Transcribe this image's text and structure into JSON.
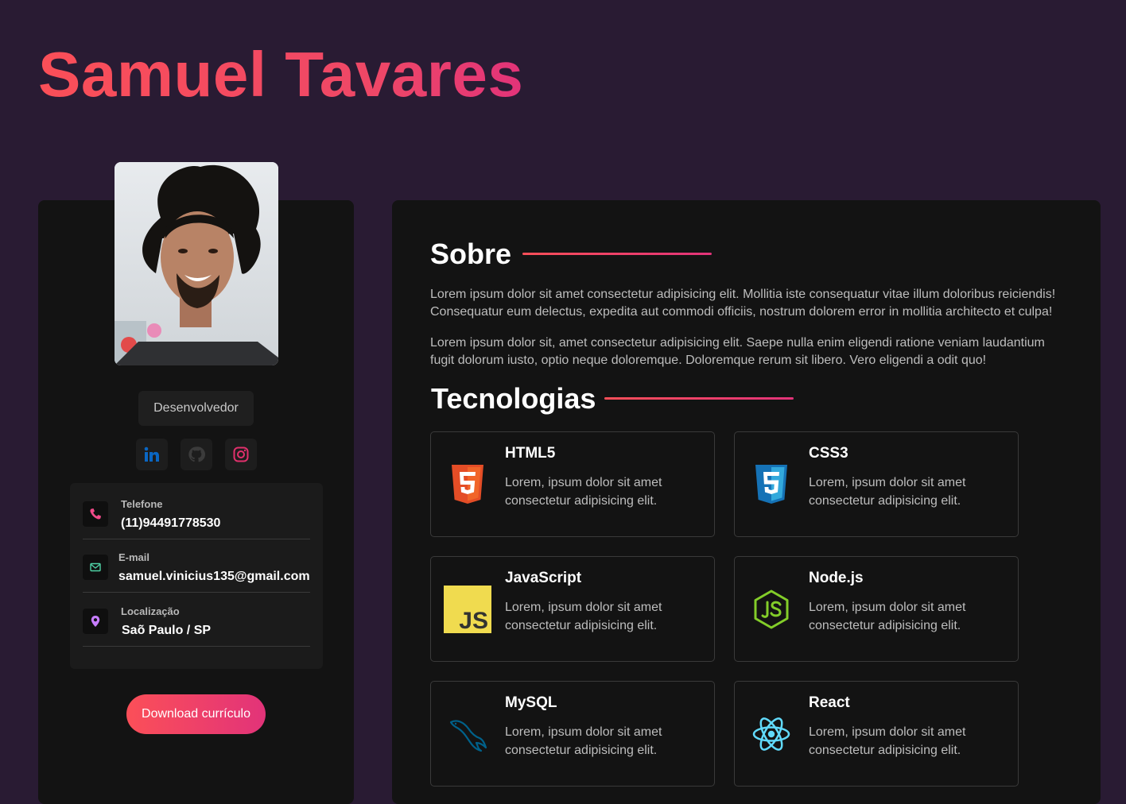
{
  "header": {
    "name": "Samuel Tavares"
  },
  "profile": {
    "role": "Desenvolvedor",
    "social": [
      {
        "icon": "linkedin-icon",
        "color": "#0a66c2"
      },
      {
        "icon": "github-icon",
        "color": "#3b3b3b"
      },
      {
        "icon": "instagram-icon",
        "color": "#e1306c"
      }
    ],
    "contacts": [
      {
        "label": "Telefone",
        "value": "(11)94491778530",
        "icon": "phone-icon",
        "color": "#f24b8a"
      },
      {
        "label": "E-mail",
        "value": "samuel.vinicius135@gmail.com",
        "icon": "mail-icon",
        "color": "#4fd1a5"
      },
      {
        "label": "Localização",
        "value": "Saõ Paulo / SP",
        "icon": "location-pin-icon",
        "color": "#c77dff"
      }
    ],
    "download_label": "Download currículo"
  },
  "about": {
    "title": "Sobre",
    "paragraphs": [
      "Lorem ipsum dolor sit amet consectetur adipisicing elit. Mollitia iste consequatur vitae illum doloribus reiciendis! Consequatur eum delectus, expedita aut commodi officiis, nostrum dolorem error in mollitia architecto et culpa!",
      "Lorem ipsum dolor sit, amet consectetur adipisicing elit. Saepe nulla enim eligendi ratione veniam laudantium fugit dolorum iusto, optio neque doloremque. Doloremque rerum sit libero. Vero eligendi a odit quo!"
    ]
  },
  "technologies": {
    "title": "Tecnologias",
    "items": [
      {
        "name": "HTML5",
        "description": "Lorem, ipsum dolor sit amet consectetur adipisicing elit.",
        "icon": "html5-icon",
        "color": "#e44d26"
      },
      {
        "name": "CSS3",
        "description": "Lorem, ipsum dolor sit amet consectetur adipisicing elit.",
        "icon": "css3-icon",
        "color": "#1572b6"
      },
      {
        "name": "JavaScript",
        "description": "Lorem, ipsum dolor sit amet consectetur adipisicing elit.",
        "icon": "javascript-icon",
        "color": "#f0db4f"
      },
      {
        "name": "Node.js",
        "description": "Lorem, ipsum dolor sit amet consectetur adipisicing elit.",
        "icon": "nodejs-icon",
        "color": "#83cd29"
      },
      {
        "name": "MySQL",
        "description": "Lorem, ipsum dolor sit amet consectetur adipisicing elit.",
        "icon": "mysql-icon",
        "color": "#00618a"
      },
      {
        "name": "React",
        "description": "Lorem, ipsum dolor sit amet consectetur adipisicing elit.",
        "icon": "react-icon",
        "color": "#61dafb"
      }
    ]
  }
}
